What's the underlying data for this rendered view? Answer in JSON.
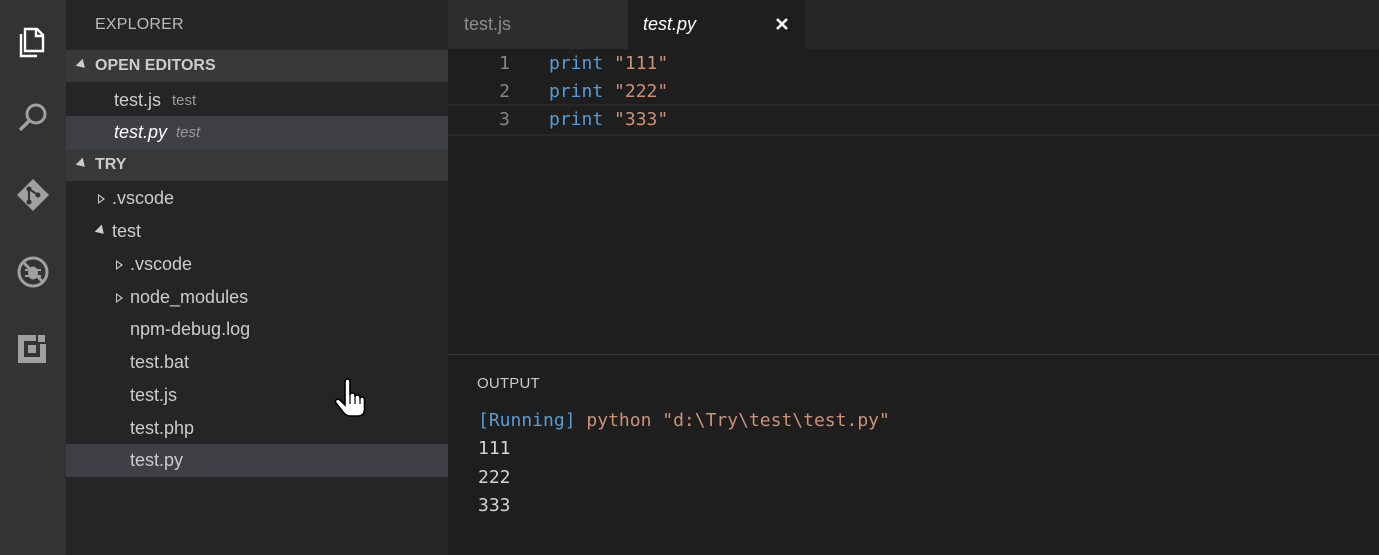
{
  "activity_bar": {
    "items": [
      {
        "name": "explorer",
        "icon": "files-icon"
      },
      {
        "name": "search",
        "icon": "search-icon"
      },
      {
        "name": "source-control",
        "icon": "git-icon"
      },
      {
        "name": "debug",
        "icon": "debug-icon"
      },
      {
        "name": "extensions",
        "icon": "extensions-icon"
      }
    ]
  },
  "sidebar": {
    "title": "EXPLORER",
    "open_editors": {
      "label": "OPEN EDITORS",
      "items": [
        {
          "name": "test.js",
          "desc": "test"
        },
        {
          "name": "test.py",
          "desc": "test"
        }
      ]
    },
    "folder": {
      "label": "TRY",
      "items": [
        {
          "name": ".vscode"
        },
        {
          "name": "test"
        },
        {
          "name": ".vscode"
        },
        {
          "name": "node_modules"
        },
        {
          "name": "npm-debug.log"
        },
        {
          "name": "test.bat"
        },
        {
          "name": "test.js"
        },
        {
          "name": "test.php"
        },
        {
          "name": "test.py"
        }
      ]
    }
  },
  "tabs": [
    {
      "label": "test.js"
    },
    {
      "label": "test.py"
    }
  ],
  "editor": {
    "lines": [
      {
        "num": "1",
        "keyword": "print",
        "string": "\"111\""
      },
      {
        "num": "2",
        "keyword": "print",
        "string": "\"222\""
      },
      {
        "num": "3",
        "keyword": "print",
        "string": "\"333\""
      }
    ]
  },
  "output": {
    "title": "OUTPUT",
    "running": "[Running]",
    "command": "python \"d:\\Try\\test\\test.py\"",
    "lines": [
      "111",
      "222",
      "333"
    ]
  },
  "colors": {
    "keyword": "#569cd6",
    "string": "#ce9178",
    "selection": "#3f3f46"
  }
}
